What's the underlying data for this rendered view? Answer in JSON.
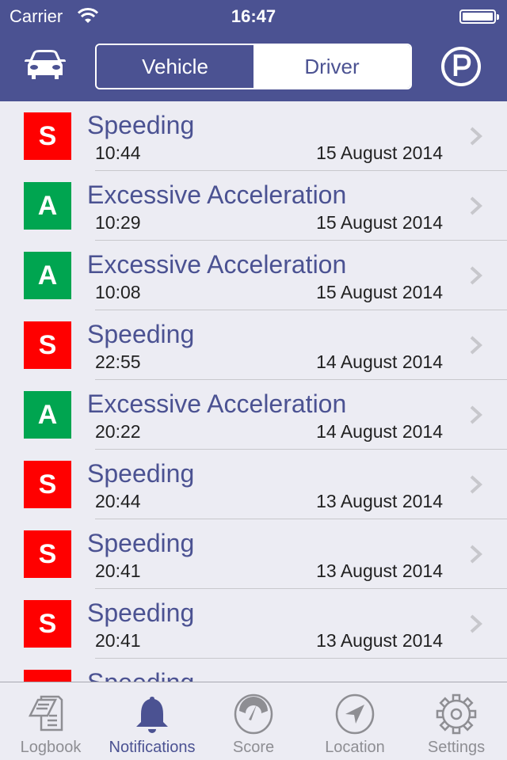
{
  "status_bar": {
    "carrier": "Carrier",
    "time": "16:47"
  },
  "header": {
    "left_icon": "car-icon",
    "right_icon": "parking-icon",
    "segments": [
      {
        "label": "Vehicle",
        "selected": true
      },
      {
        "label": "Driver",
        "selected": false
      }
    ]
  },
  "colors": {
    "brand": "#4b5292",
    "speeding": "#ff0000",
    "acceleration": "#00a550",
    "background": "#ececf3"
  },
  "notifications": [
    {
      "badge": "S",
      "type": "speeding",
      "title": "Speeding",
      "time": "10:44",
      "date": "15 August 2014"
    },
    {
      "badge": "A",
      "type": "acceleration",
      "title": "Excessive Acceleration",
      "time": "10:29",
      "date": "15 August 2014"
    },
    {
      "badge": "A",
      "type": "acceleration",
      "title": "Excessive Acceleration",
      "time": "10:08",
      "date": "15 August 2014"
    },
    {
      "badge": "S",
      "type": "speeding",
      "title": "Speeding",
      "time": "22:55",
      "date": "14 August 2014"
    },
    {
      "badge": "A",
      "type": "acceleration",
      "title": "Excessive Acceleration",
      "time": "20:22",
      "date": "14 August 2014"
    },
    {
      "badge": "S",
      "type": "speeding",
      "title": "Speeding",
      "time": "20:44",
      "date": "13 August 2014"
    },
    {
      "badge": "S",
      "type": "speeding",
      "title": "Speeding",
      "time": "20:41",
      "date": "13 August 2014"
    },
    {
      "badge": "S",
      "type": "speeding",
      "title": "Speeding",
      "time": "20:41",
      "date": "13 August 2014"
    },
    {
      "badge": "S",
      "type": "speeding",
      "title": "Speeding",
      "time": "",
      "date": ""
    }
  ],
  "tabbar": {
    "tabs": [
      {
        "label": "Logbook",
        "icon": "logbook-icon",
        "active": false
      },
      {
        "label": "Notifications",
        "icon": "bell-icon",
        "active": true
      },
      {
        "label": "Score",
        "icon": "gauge-icon",
        "active": false
      },
      {
        "label": "Location",
        "icon": "location-arrow-icon",
        "active": false
      },
      {
        "label": "Settings",
        "icon": "gear-icon",
        "active": false
      }
    ]
  }
}
